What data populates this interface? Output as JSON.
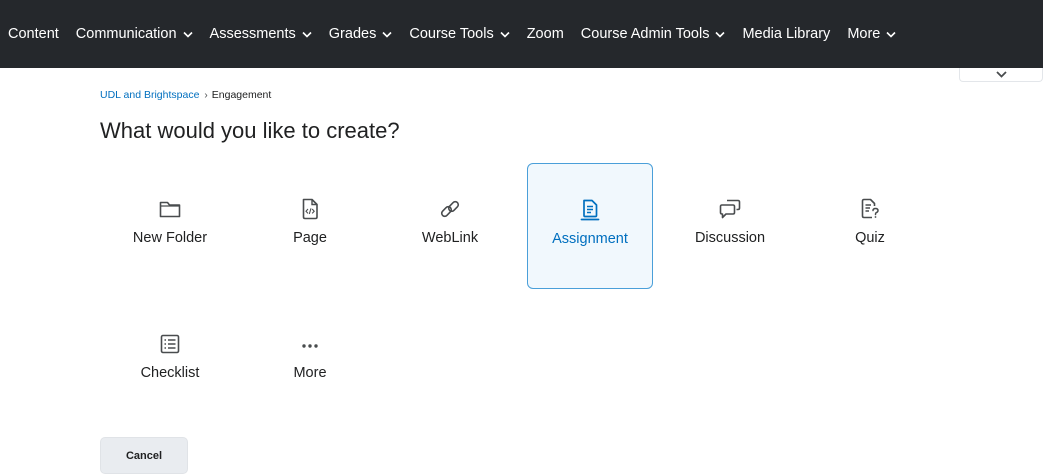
{
  "nav": {
    "items": [
      {
        "label": "Content",
        "has_dropdown": false
      },
      {
        "label": "Communication",
        "has_dropdown": true
      },
      {
        "label": "Assessments",
        "has_dropdown": true
      },
      {
        "label": "Grades",
        "has_dropdown": true
      },
      {
        "label": "Course Tools",
        "has_dropdown": true
      },
      {
        "label": "Zoom",
        "has_dropdown": false
      },
      {
        "label": "Course Admin Tools",
        "has_dropdown": true
      },
      {
        "label": "Media Library",
        "has_dropdown": false
      },
      {
        "label": "More",
        "has_dropdown": true
      }
    ],
    "colors": {
      "background": "#25282c",
      "text": "#ffffff"
    }
  },
  "breadcrumb": {
    "parent": "UDL and Brightspace",
    "separator": "›",
    "current": "Engagement"
  },
  "page": {
    "title": "What would you like to create?"
  },
  "options": [
    {
      "label": "New Folder",
      "icon": "folder-icon",
      "selected": false
    },
    {
      "label": "Page",
      "icon": "page-code-icon",
      "selected": false
    },
    {
      "label": "WebLink",
      "icon": "link-icon",
      "selected": false
    },
    {
      "label": "Assignment",
      "icon": "assignment-icon",
      "selected": true
    },
    {
      "label": "Discussion",
      "icon": "discussion-icon",
      "selected": false
    },
    {
      "label": "Quiz",
      "icon": "quiz-icon",
      "selected": false
    },
    {
      "label": "Checklist",
      "icon": "checklist-icon",
      "selected": false
    },
    {
      "label": "More",
      "icon": "more-dots-icon",
      "selected": false
    }
  ],
  "actions": {
    "cancel_label": "Cancel"
  },
  "colors": {
    "accent": "#006fbf",
    "selected_border": "#4a9fd9",
    "selected_background": "#f1f8fd",
    "button_background": "#e9ecf0"
  }
}
